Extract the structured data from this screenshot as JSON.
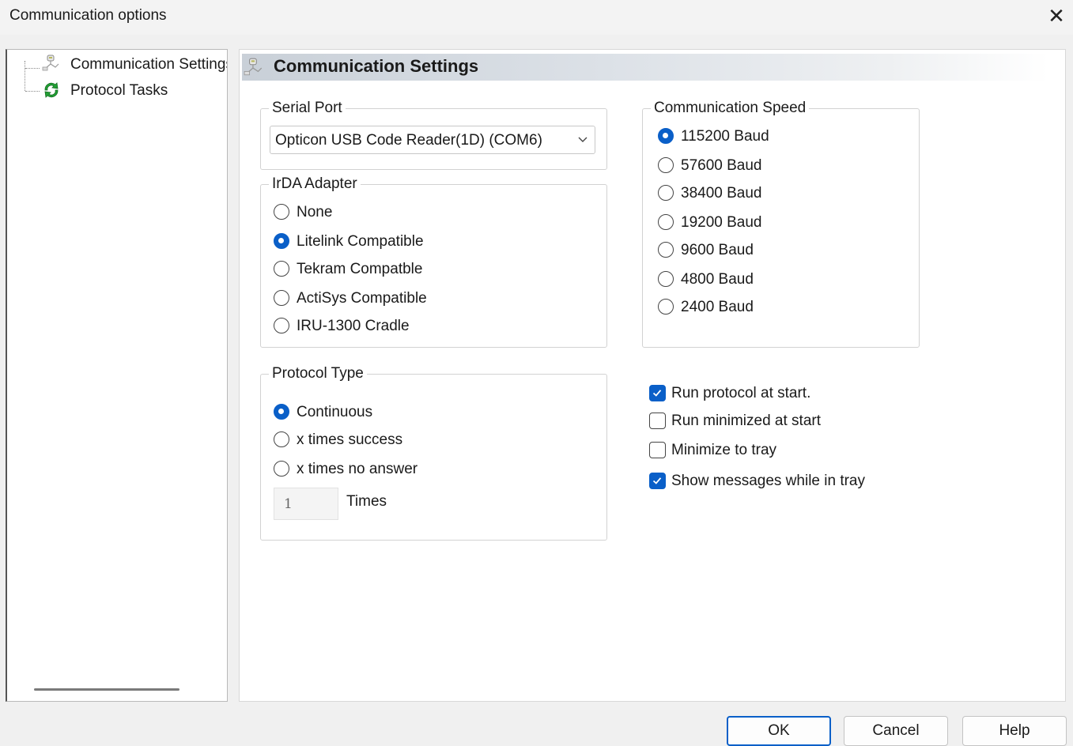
{
  "window": {
    "title": "Communication options",
    "close_glyph": "✕"
  },
  "tree": {
    "items": [
      {
        "label": "Communication Settings",
        "icon": "communication-settings-icon"
      },
      {
        "label": "Protocol Tasks",
        "icon": "protocol-tasks-icon"
      }
    ]
  },
  "panel": {
    "title": "Communication Settings"
  },
  "serial_port": {
    "legend": "Serial Port",
    "selected": "Opticon USB Code Reader(1D) (COM6)"
  },
  "irda": {
    "legend": "IrDA Adapter",
    "options": [
      "None",
      "Litelink Compatible",
      "Tekram Compatble",
      "ActiSys Compatible",
      "IRU-1300 Cradle"
    ],
    "selected": "Litelink Compatible"
  },
  "speed": {
    "legend": "Communication Speed",
    "options": [
      "115200 Baud",
      "57600 Baud",
      "38400 Baud",
      "19200 Baud",
      "9600 Baud",
      "4800 Baud",
      "2400 Baud"
    ],
    "selected": "115200 Baud"
  },
  "protocol_type": {
    "legend": "Protocol Type",
    "options": [
      "Continuous",
      "x times success",
      "x times no answer"
    ],
    "selected": "Continuous",
    "times_value": "1",
    "times_label": "Times"
  },
  "checkboxes": [
    {
      "label": "Run protocol at start.",
      "checked": true
    },
    {
      "label": "Run minimized at start",
      "checked": false
    },
    {
      "label": "Minimize to tray",
      "checked": false
    },
    {
      "label": "Show messages while in tray",
      "checked": true
    }
  ],
  "buttons": {
    "ok": "OK",
    "cancel": "Cancel",
    "help": "Help"
  },
  "colors": {
    "accent": "#0a5fc8",
    "header_gradient_start": "#c9d0d8",
    "tree_icon_green": "#22a035"
  }
}
